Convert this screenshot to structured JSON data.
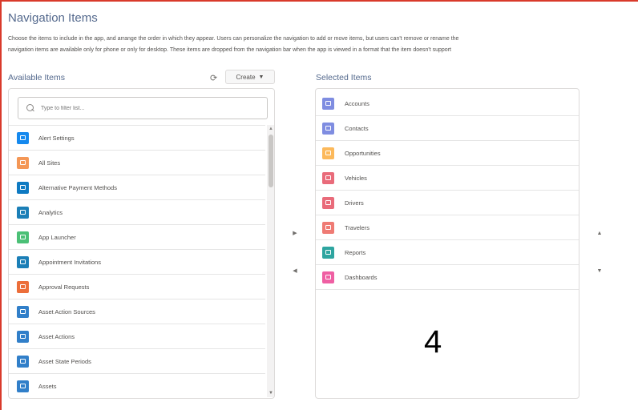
{
  "section_title": "Navigation Items",
  "description": {
    "line1": "Choose the items to include in the app, and arrange the order in which they appear. Users can personalize the navigation to add or move items, but users can't remove or rename the",
    "line2": "navigation items are available only for phone or only for desktop. These items are dropped from the navigation bar when the app is viewed in a format that the item doesn't support"
  },
  "available": {
    "title": "Available Items",
    "refresh_glyph": "⟳",
    "create_label": "Create",
    "create_caret": "▼",
    "search_placeholder": "Type to filter list...",
    "items": [
      {
        "label": "Alert Settings",
        "icon": "alert-settings-icon",
        "color": "#1589ee"
      },
      {
        "label": "All Sites",
        "icon": "all-sites-icon",
        "color": "#f49756"
      },
      {
        "label": "Alternative Payment Methods",
        "icon": "payment-methods-icon",
        "color": "#0e7ac2"
      },
      {
        "label": "Analytics",
        "icon": "analytics-icon",
        "color": "#1b7fb7"
      },
      {
        "label": "App Launcher",
        "icon": "app-launcher-icon",
        "color": "#4bc076"
      },
      {
        "label": "Appointment Invitations",
        "icon": "appointment-invitations-icon",
        "color": "#1b7fb7"
      },
      {
        "label": "Approval Requests",
        "icon": "approval-requests-icon",
        "color": "#ec6e3a"
      },
      {
        "label": "Asset Action Sources",
        "icon": "asset-action-sources-icon",
        "color": "#317fc9"
      },
      {
        "label": "Asset Actions",
        "icon": "asset-actions-icon",
        "color": "#317fc9"
      },
      {
        "label": "Asset State Periods",
        "icon": "asset-state-periods-icon",
        "color": "#317fc9"
      },
      {
        "label": "Assets",
        "icon": "assets-icon",
        "color": "#317fc9"
      }
    ]
  },
  "selected": {
    "title": "Selected Items",
    "items": [
      {
        "label": "Accounts",
        "icon": "accounts-icon",
        "color": "#7f8de1"
      },
      {
        "label": "Contacts",
        "icon": "contacts-icon",
        "color": "#7f8de1"
      },
      {
        "label": "Opportunities",
        "icon": "opportunities-icon",
        "color": "#fcb95b"
      },
      {
        "label": "Vehicles",
        "icon": "vehicles-icon",
        "color": "#e96b7a"
      },
      {
        "label": "Drivers",
        "icon": "drivers-icon",
        "color": "#e96b7a"
      },
      {
        "label": "Travelers",
        "icon": "travelers-icon",
        "color": "#ef7b74"
      },
      {
        "label": "Reports",
        "icon": "reports-icon",
        "color": "#2ea5a0"
      },
      {
        "label": "Dashboards",
        "icon": "dashboards-icon",
        "color": "#ef5fa3"
      }
    ]
  },
  "controls": {
    "move_right": "▶",
    "move_left": "◀",
    "move_up": "▲",
    "move_down": "▼",
    "scroll_up": "▲",
    "scroll_down": "▼"
  },
  "annotation_number": "4"
}
